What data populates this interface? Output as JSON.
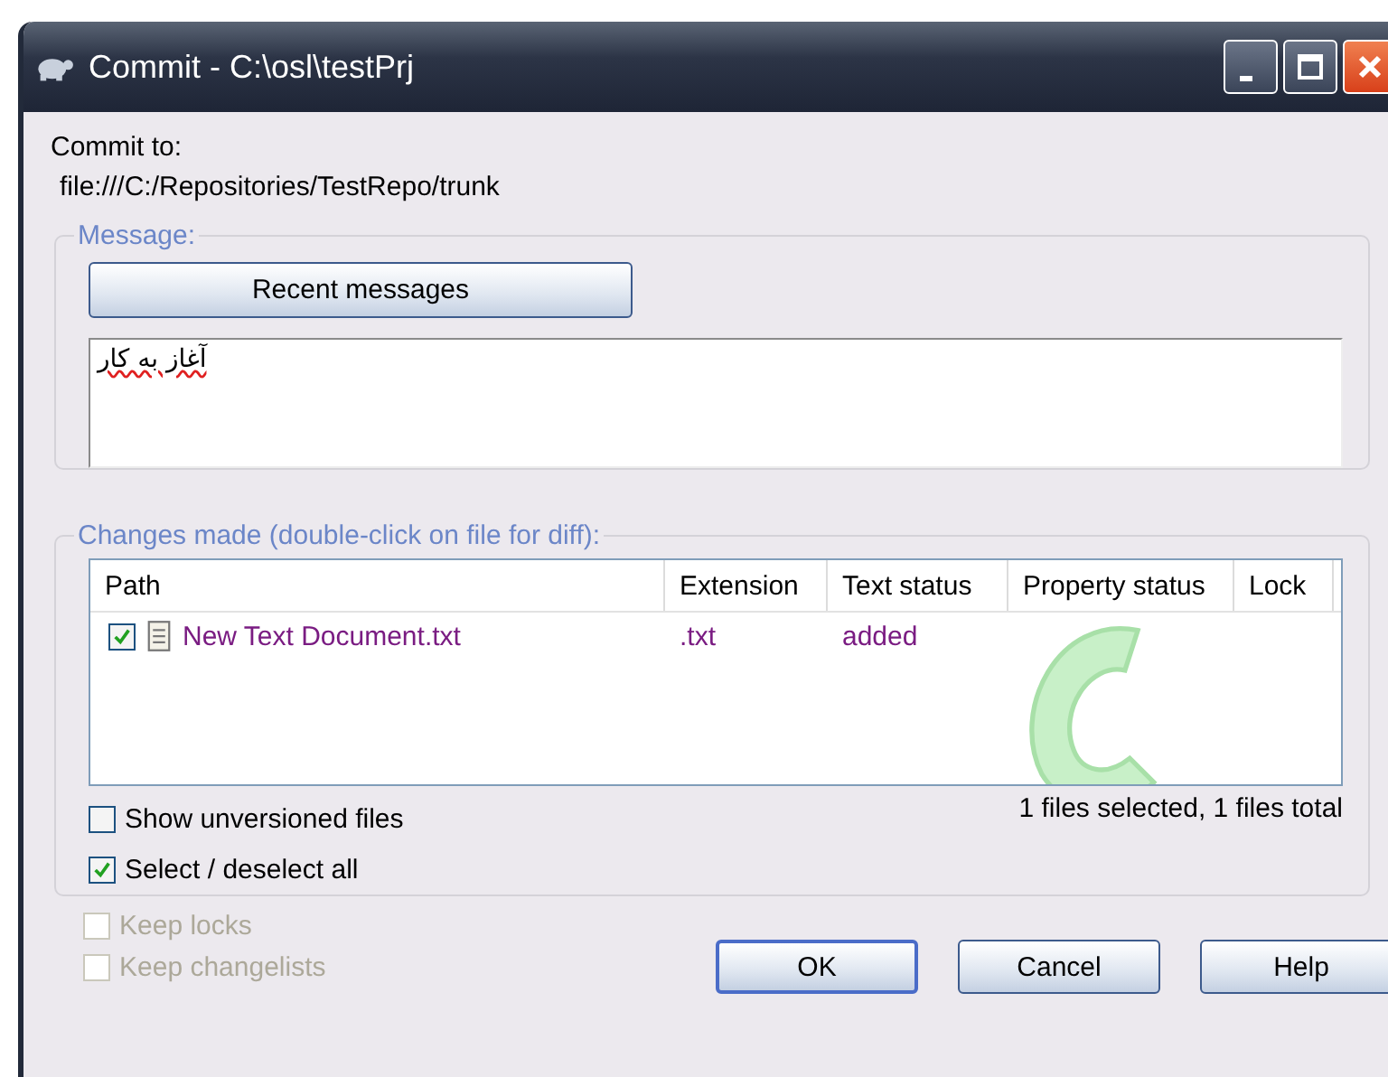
{
  "window": {
    "title": "Commit - C:\\osl\\testPrj"
  },
  "commit_to": {
    "label": "Commit to:",
    "url": "file:///C:/Repositories/TestRepo/trunk"
  },
  "message": {
    "group_label": "Message:",
    "recent_button": "Recent messages",
    "value": "آغاز به کار"
  },
  "changes": {
    "group_label": "Changes made (double-click on file for diff):",
    "columns": [
      "Path",
      "Extension",
      "Text status",
      "Property status",
      "Lock"
    ],
    "rows": [
      {
        "checked": true,
        "path": "New Text Document.txt",
        "extension": ".txt",
        "text_status": "added"
      }
    ],
    "summary": "1 files selected, 1 files total",
    "options": [
      {
        "label": "Show unversioned files",
        "checked": false
      },
      {
        "label": "Select / deselect all",
        "checked": true
      }
    ]
  },
  "bottom_options": [
    {
      "label": "Keep locks",
      "checked": false,
      "disabled": true
    },
    {
      "label": "Keep changelists",
      "checked": false,
      "disabled": true
    }
  ],
  "buttons": [
    {
      "label": "OK",
      "default": true
    },
    {
      "label": "Cancel",
      "default": false
    },
    {
      "label": "Help",
      "default": false
    }
  ]
}
